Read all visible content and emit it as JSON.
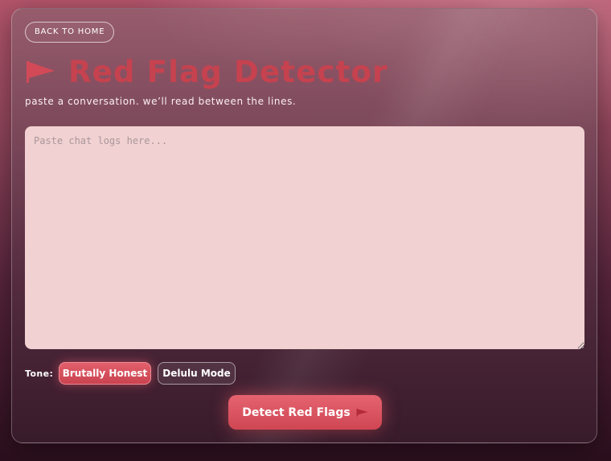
{
  "nav": {
    "back_label": "BACK TO HOME"
  },
  "header": {
    "icon": "red-flag-icon",
    "title": "Red Flag Detector",
    "subtitle": "paste a conversation. we’ll read between the lines."
  },
  "chat_input": {
    "value": "",
    "placeholder": "Paste chat logs here..."
  },
  "tone": {
    "label": "Tone:",
    "options": [
      {
        "label": "Brutally Honest",
        "selected": true
      },
      {
        "label": "Delulu Mode",
        "selected": false
      }
    ]
  },
  "action": {
    "detect_label": "Detect Red Flags",
    "icon": "red-flag-icon"
  },
  "colors": {
    "accent": "#d64b58",
    "title": "#c6424f",
    "input_background": "#f1d1d1"
  }
}
